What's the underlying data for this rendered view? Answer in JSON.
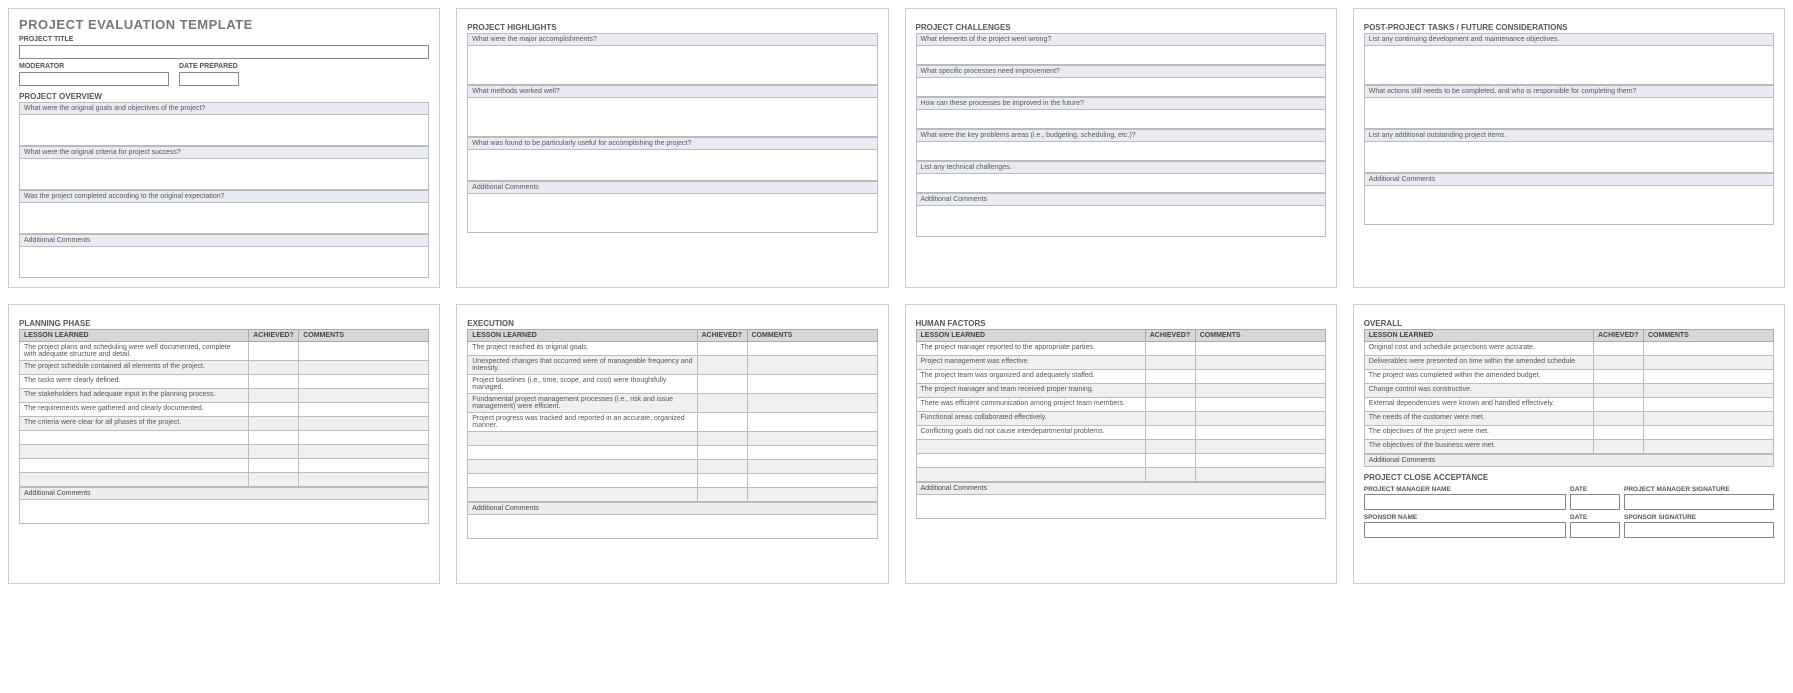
{
  "page1": {
    "title": "PROJECT EVALUATION TEMPLATE",
    "project_title_label": "PROJECT TITLE",
    "moderator_label": "MODERATOR",
    "date_prepared_label": "DATE PREPARED",
    "overview_label": "PROJECT OVERVIEW",
    "q1": "What were the original goals and objectives of the project?",
    "q2": "What were the original criteria for project success?",
    "q3": "Was the project completed according to the original expectation?",
    "additional": "Additional Comments"
  },
  "page2": {
    "title": "PROJECT HIGHLIGHTS",
    "q1": "What were the major accomplishments?",
    "q2": "What methods worked well?",
    "q3": "What was found to be particularly useful for accomplishing the project?",
    "additional": "Additional Comments"
  },
  "page3": {
    "title": "PROJECT CHALLENGES",
    "q1": "What elements of the project went wrong?",
    "q2": "What specific processes need improvement?",
    "q3": "How can these processes be improved in the future?",
    "q4": "What were the key problems areas (i.e., budgeting, scheduling, etc.)?",
    "q5": "List any technical challenges.",
    "additional": "Additional Comments"
  },
  "page4": {
    "title": "POST-PROJECT TASKS / FUTURE CONSIDERATIONS",
    "q1": "List any continuing development and maintenance objectives.",
    "q2": "What actions still needs to be completed, and who is responsible for completing them?",
    "q3": "List any additional outstanding project items.",
    "additional": "Additional Comments"
  },
  "page5": {
    "title": "PLANNING PHASE",
    "col1": "LESSON LEARNED",
    "col2": "ACHIEVED?",
    "col3": "COMMENTS",
    "rows": [
      "The project plans and scheduling were well documented, complete with adequate structure and detail.",
      "The project schedule contained all elements of the project.",
      "The tasks were clearly defined.",
      "The stakeholders had adequate input in the planning process.",
      "The requirements were gathered and clearly documented.",
      "The criteria were clear for all phases of the project."
    ],
    "additional": "Additional Comments"
  },
  "page6": {
    "title": "EXECUTION",
    "col1": "LESSON LEARNED",
    "col2": "ACHIEVED?",
    "col3": "COMMENTS",
    "rows": [
      "The project reached its original goals.",
      "Unexpected changes that occurred were of manageable frequency and intensity.",
      "Project baselines (i.e., time, scope, and cost) were thoughtfully managed.",
      "Fundamental project management processes (i.e., risk and issue management) were efficient.",
      "Project progress was tracked and reported in an accurate, organized manner."
    ],
    "additional": "Additional Comments"
  },
  "page7": {
    "title": "HUMAN FACTORS",
    "col1": "LESSON LEARNED",
    "col2": "ACHIEVED?",
    "col3": "COMMENTS",
    "rows": [
      "The project manager reported to the appropriate parties.",
      "Project management was effective.",
      "The project team was organized and adequately staffed.",
      "The project manager and team received proper training.",
      "There was efficient communication among project team members.",
      "Functional areas collaborated effectively.",
      "Conflicting goals did not cause interdepartmental problems."
    ],
    "additional": "Additional Comments"
  },
  "page8": {
    "title": "OVERALL",
    "col1": "LESSON LEARNED",
    "col2": "ACHIEVED?",
    "col3": "COMMENTS",
    "rows": [
      "Original cost and schedule projections were accurate.",
      "Deliverables were presented on time within the amended schedule.",
      "The project was completed within the amended budget.",
      "Change control was constructive.",
      "External dependencies were known and handled effectively.",
      "The needs of the customer were met.",
      "The objectives of the project were met.",
      "The objectives of the business were met."
    ],
    "additional": "Additional Comments",
    "acceptance_title": "PROJECT CLOSE ACCEPTANCE",
    "pm_name": "PROJECT MANAGER NAME",
    "date": "DATE",
    "pm_sig": "PROJECT MANAGER SIGNATURE",
    "sponsor_name": "SPONSOR NAME",
    "sponsor_sig": "SPONSOR SIGNATURE"
  }
}
